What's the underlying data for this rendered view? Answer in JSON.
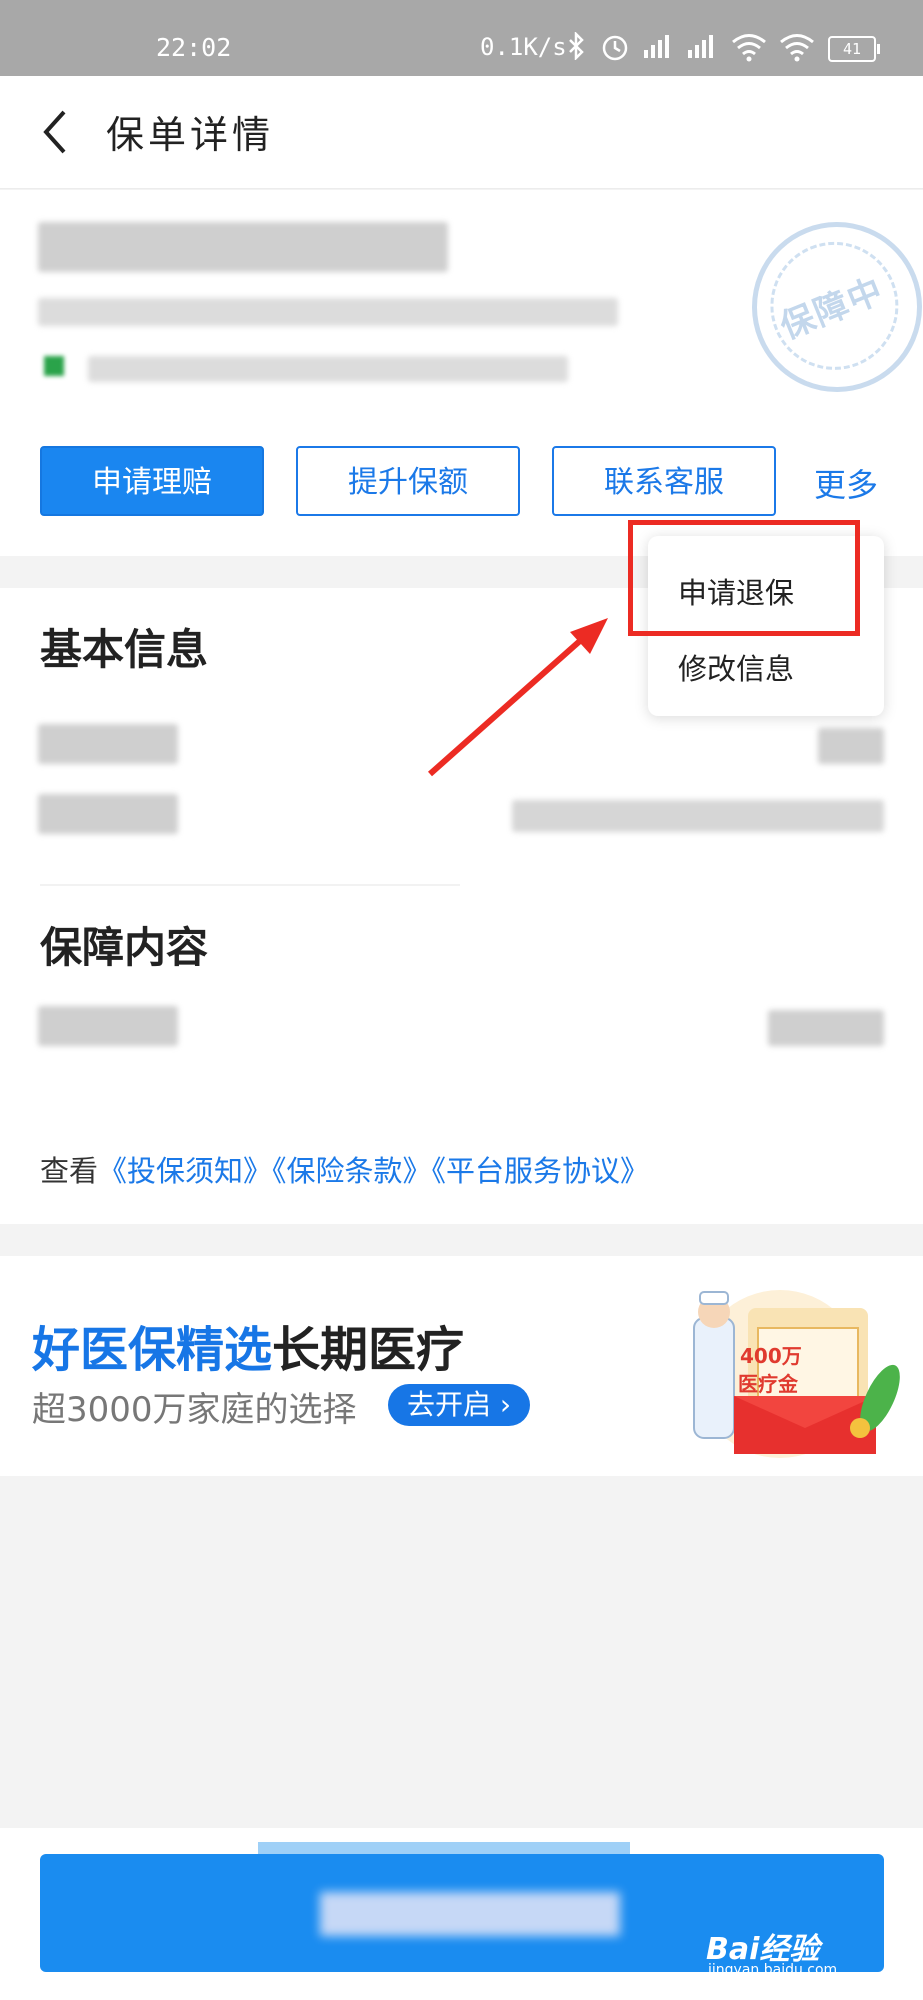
{
  "status_bar": {
    "time": "22:02",
    "network_speed": "0.1K/s",
    "battery": "41"
  },
  "header": {
    "title": "保单详情",
    "back_icon": "chevron-left-icon"
  },
  "policy": {
    "status_stamp": "保障中",
    "actions": [
      {
        "label": "申请理赔"
      },
      {
        "label": "提升保额"
      },
      {
        "label": "联系客服"
      }
    ],
    "more_label": "更多"
  },
  "more_menu": {
    "items": [
      {
        "label": "申请退保"
      },
      {
        "label": "修改信息"
      }
    ]
  },
  "sections": {
    "basic_info_title": "基本信息",
    "coverage_title": "保障内容"
  },
  "documents": {
    "prefix": "查看",
    "links": [
      "《投保须知》",
      "《保险条款》",
      "《平台服务协议》"
    ]
  },
  "promo": {
    "title_blue": "好医保精选",
    "title_dark": "长期医疗",
    "subtitle": "超3000万家庭的选择",
    "button": "去开启 ›",
    "envelope_line1": "400万",
    "envelope_line2": "医疗金"
  },
  "watermark": {
    "brand": "Bai经验",
    "sub": "jingyan.baidu.com"
  },
  "colors": {
    "accent": "#1b79e8",
    "highlight_box": "#ec2b23"
  }
}
